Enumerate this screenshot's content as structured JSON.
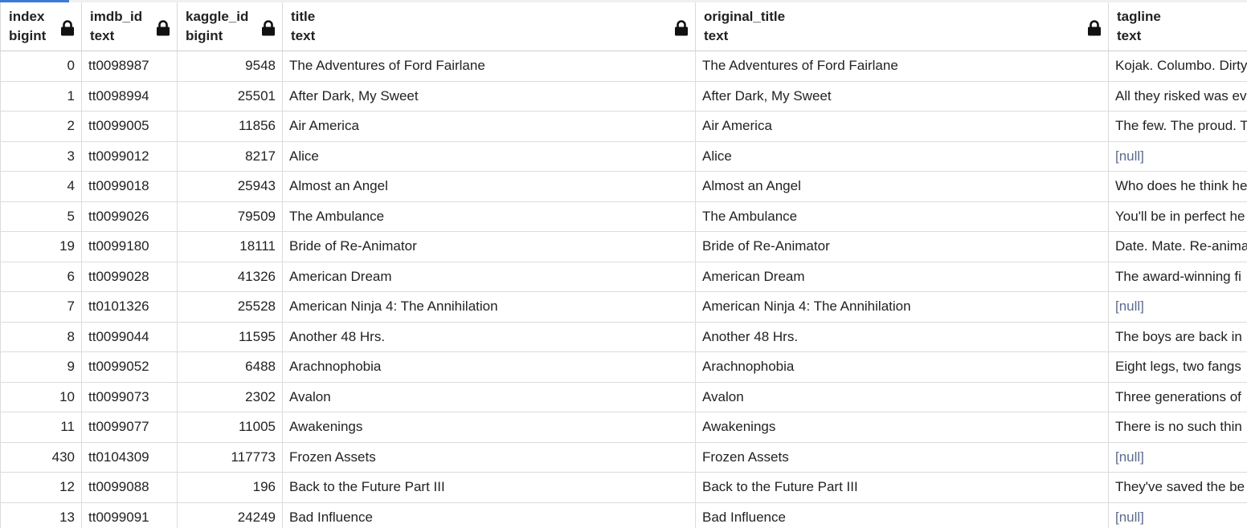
{
  "columns": [
    {
      "name": "index",
      "type": "bigint",
      "locked": true
    },
    {
      "name": "imdb_id",
      "type": "text",
      "locked": true
    },
    {
      "name": "kaggle_id",
      "type": "bigint",
      "locked": true
    },
    {
      "name": "title",
      "type": "text",
      "locked": true
    },
    {
      "name": "original_title",
      "type": "text",
      "locked": true
    },
    {
      "name": "tagline",
      "type": "text",
      "locked": false
    }
  ],
  "rows": [
    [
      "0",
      "tt0098987",
      "9548",
      "The Adventures of Ford Fairlane",
      "The Adventures of Ford Fairlane",
      "Kojak. Columbo. Dirty"
    ],
    [
      "1",
      "tt0098994",
      "25501",
      "After Dark, My Sweet",
      "After Dark, My Sweet",
      "All they risked was ev"
    ],
    [
      "2",
      "tt0099005",
      "11856",
      "Air America",
      "Air America",
      "The few. The proud. T"
    ],
    [
      "3",
      "tt0099012",
      "8217",
      "Alice",
      "Alice",
      "[null]"
    ],
    [
      "4",
      "tt0099018",
      "25943",
      "Almost an Angel",
      "Almost an Angel",
      "Who does he think he"
    ],
    [
      "5",
      "tt0099026",
      "79509",
      "The Ambulance",
      "The Ambulance",
      "You'll be in perfect he"
    ],
    [
      "19",
      "tt0099180",
      "18111",
      "Bride of Re-Animator",
      "Bride of Re-Animator",
      "Date. Mate. Re-anima"
    ],
    [
      "6",
      "tt0099028",
      "41326",
      "American Dream",
      "American Dream",
      "The award-winning fi"
    ],
    [
      "7",
      "tt0101326",
      "25528",
      "American Ninja 4: The Annihilation",
      "American Ninja 4: The Annihilation",
      "[null]"
    ],
    [
      "8",
      "tt0099044",
      "11595",
      "Another 48 Hrs.",
      "Another 48 Hrs.",
      "The boys are back in"
    ],
    [
      "9",
      "tt0099052",
      "6488",
      "Arachnophobia",
      "Arachnophobia",
      "Eight legs, two fangs"
    ],
    [
      "10",
      "tt0099073",
      "2302",
      "Avalon",
      "Avalon",
      "Three generations of"
    ],
    [
      "11",
      "tt0099077",
      "11005",
      "Awakenings",
      "Awakenings",
      "There is no such thin"
    ],
    [
      "430",
      "tt0104309",
      "117773",
      "Frozen Assets",
      "Frozen Assets",
      "[null]"
    ],
    [
      "12",
      "tt0099088",
      "196",
      "Back to the Future Part III",
      "Back to the Future Part III",
      "They've saved the be"
    ],
    [
      "13",
      "tt0099091",
      "24249",
      "Bad Influence",
      "Bad Influence",
      "[null]"
    ]
  ],
  "null_marker": "[null]",
  "icons": {
    "lock": "lock-icon"
  },
  "colors": {
    "accent": "#3a7bd5",
    "null_text": "#5b6b8c"
  }
}
